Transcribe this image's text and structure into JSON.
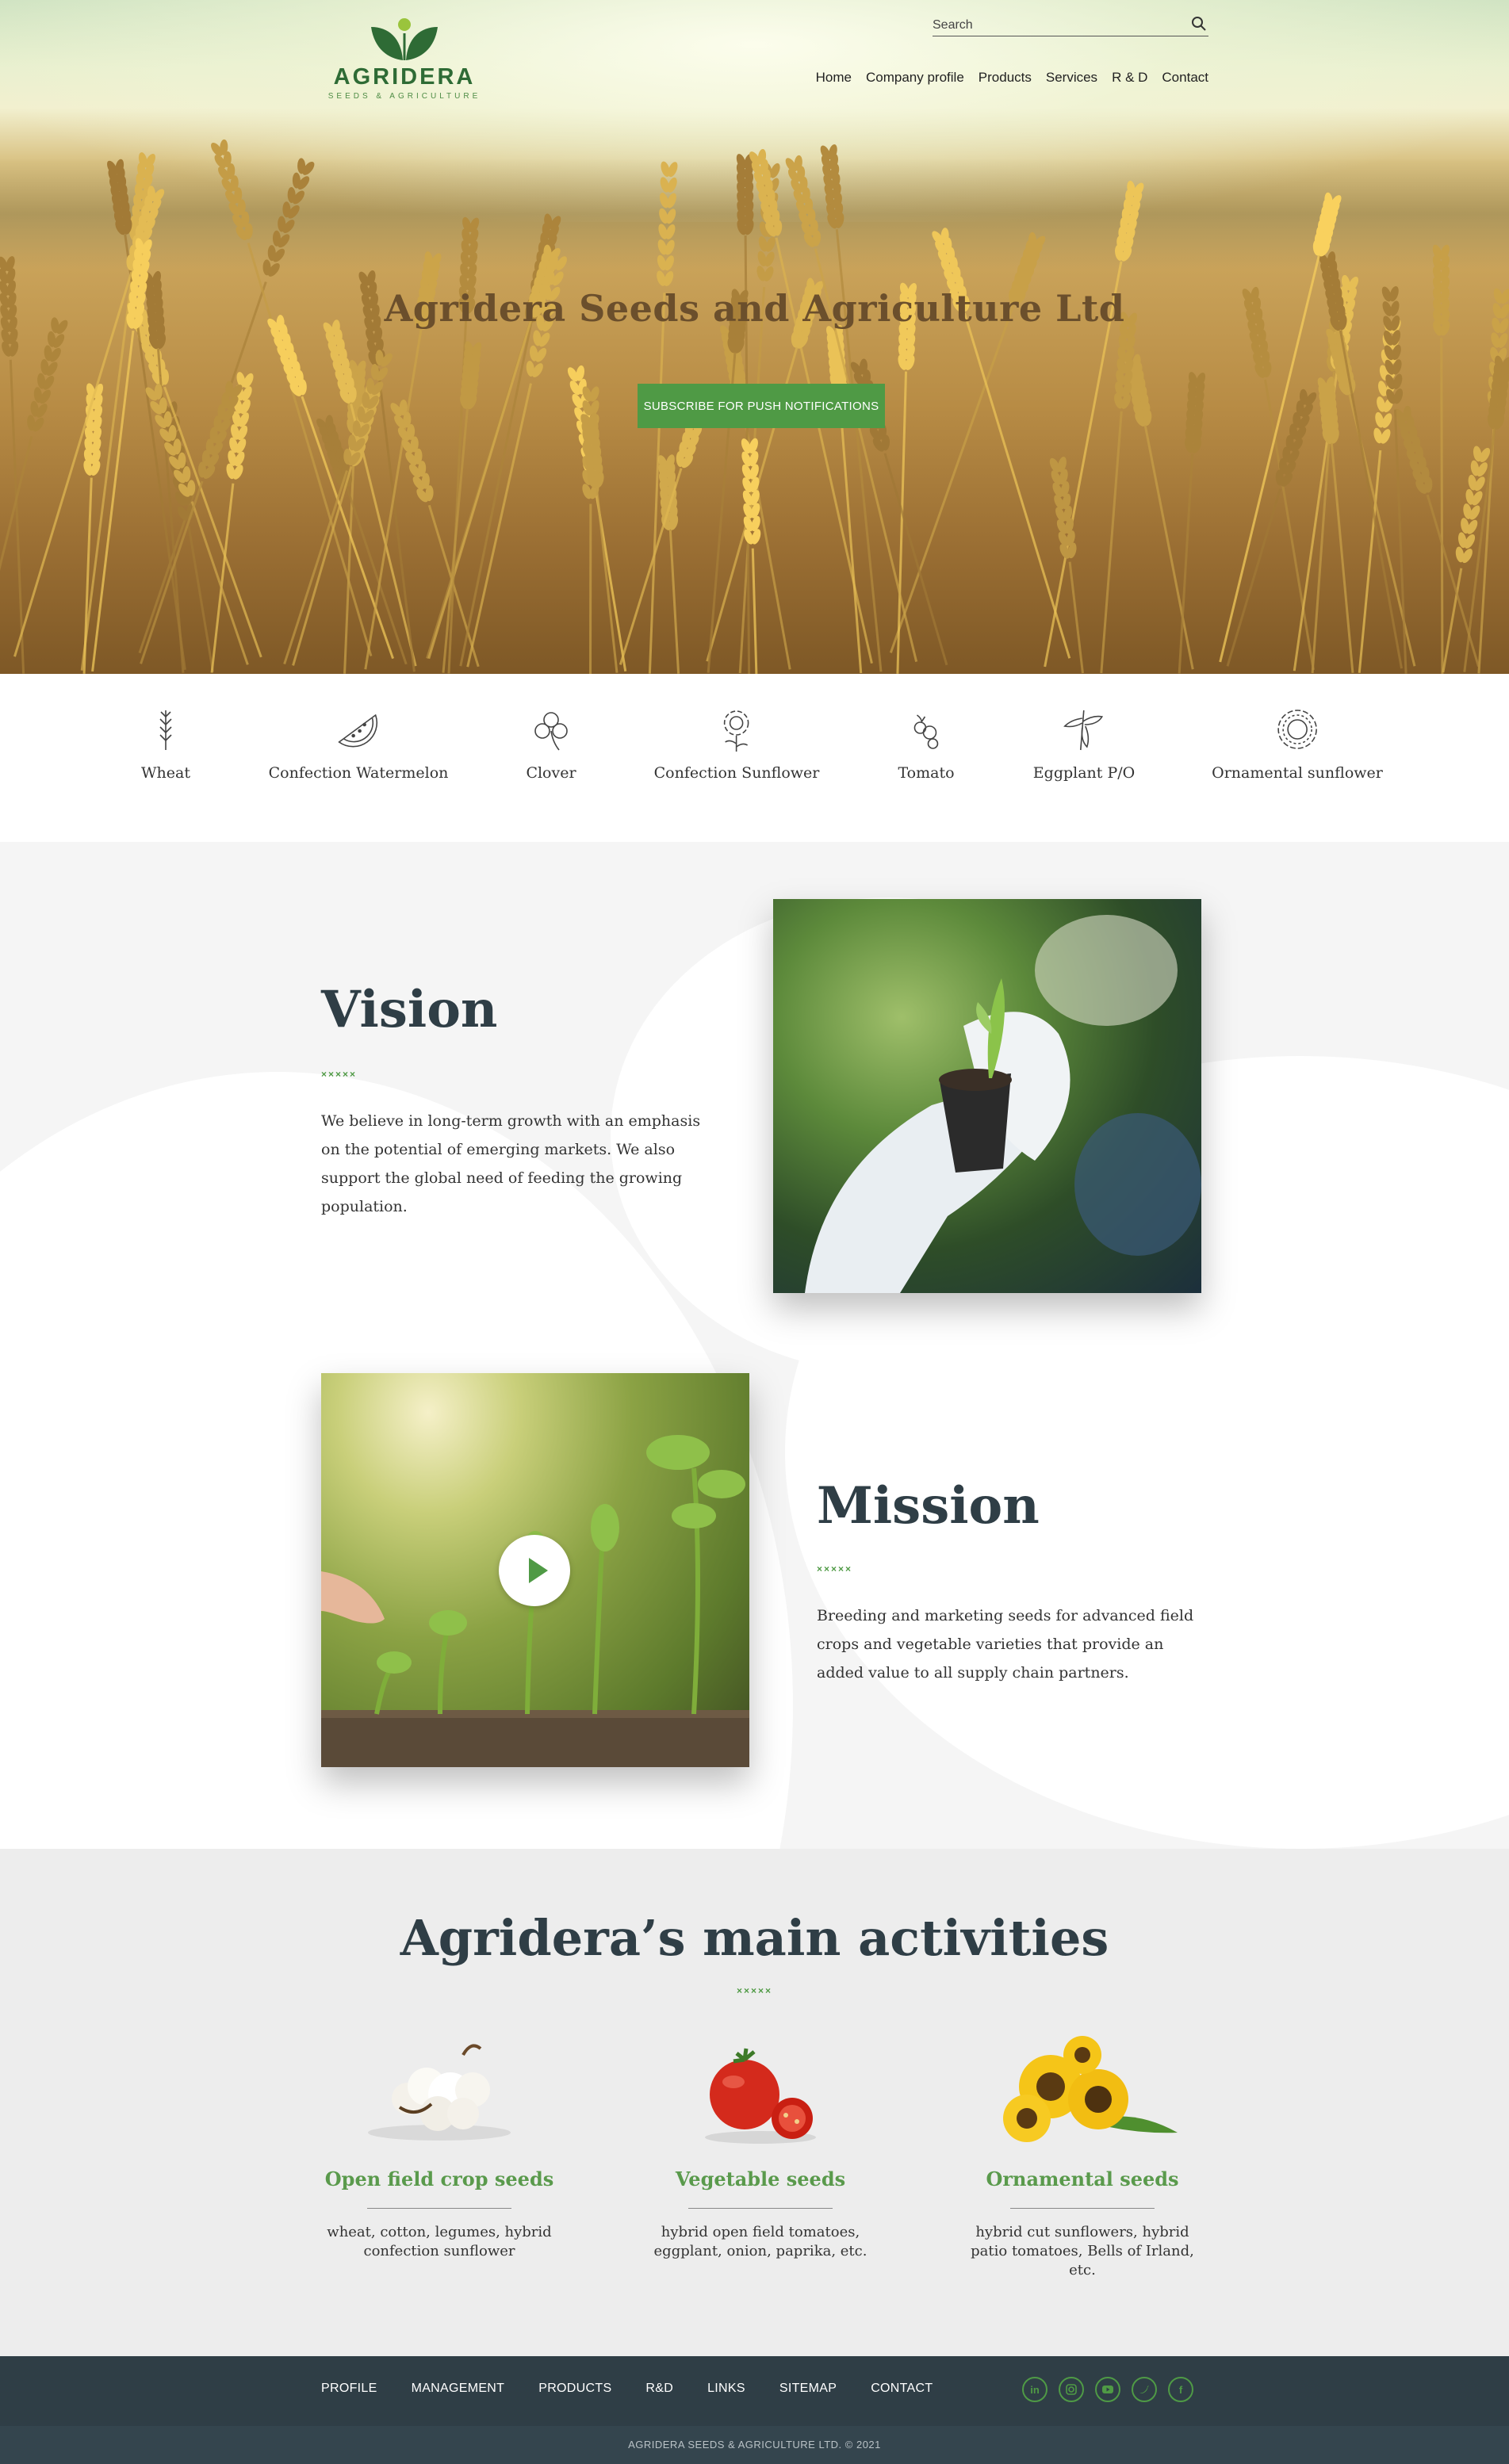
{
  "brand": {
    "name": "AGRIDERA",
    "tagline": "SEEDS & AGRICULTURE",
    "green": "#2e6b35",
    "accent": "#4f9a45"
  },
  "search": {
    "placeholder": "Search",
    "icon": "search-icon"
  },
  "nav": [
    "Home",
    "Company profile",
    "Products",
    "Services",
    "R & D",
    "Contact"
  ],
  "hero": {
    "title": "Agridera Seeds and Agriculture Ltd",
    "button": "SUBSCRIBE FOR PUSH NOTIFICATIONS"
  },
  "categories": [
    {
      "label": "Wheat",
      "icon": "wheat-icon"
    },
    {
      "label": "Confection Watermelon",
      "icon": "watermelon-icon"
    },
    {
      "label": "Clover",
      "icon": "clover-icon"
    },
    {
      "label": "Confection Sunflower",
      "icon": "sunflower-icon"
    },
    {
      "label": "Tomato",
      "icon": "tomato-icon"
    },
    {
      "label": "Eggplant P/O",
      "icon": "eggplant-icon"
    },
    {
      "label": "Ornamental sunflower",
      "icon": "ornamental-sunflower-icon"
    }
  ],
  "vision": {
    "title": "Vision",
    "dots": "×××××",
    "text": "We believe in long-term growth with an emphasis on the potential of emerging markets. We also support the global need of feeding the growing population."
  },
  "mission": {
    "title": "Mission",
    "dots": "×××××",
    "text": "Breeding and marketing seeds for advanced field crops and vegetable varieties that provide an added value to all supply chain partners."
  },
  "activities": {
    "title": "Agridera’s main activities",
    "dots": "×××××",
    "items": [
      {
        "title": "Open field crop seeds",
        "text": "wheat, cotton, legumes, hybrid confection sunflower",
        "icon": "cotton-image"
      },
      {
        "title": "Vegetable seeds",
        "text": "hybrid open field tomatoes, eggplant, onion, paprika, etc.",
        "icon": "tomato-image"
      },
      {
        "title": "Ornamental seeds",
        "text": "hybrid cut sunflowers, hybrid patio tomatoes, Bells of Irland, etc.",
        "icon": "sunflower-image"
      }
    ]
  },
  "footer": {
    "links": [
      "PROFILE",
      "MANAGEMENT",
      "PRODUCTS",
      "R&D",
      "LINKS",
      "SITEMAP",
      "CONTACT"
    ],
    "social": [
      "in",
      "ig",
      "yt",
      "tw",
      "f"
    ],
    "copyright": "AGRIDERA SEEDS & AGRICULTURE LTD. © 2021"
  }
}
